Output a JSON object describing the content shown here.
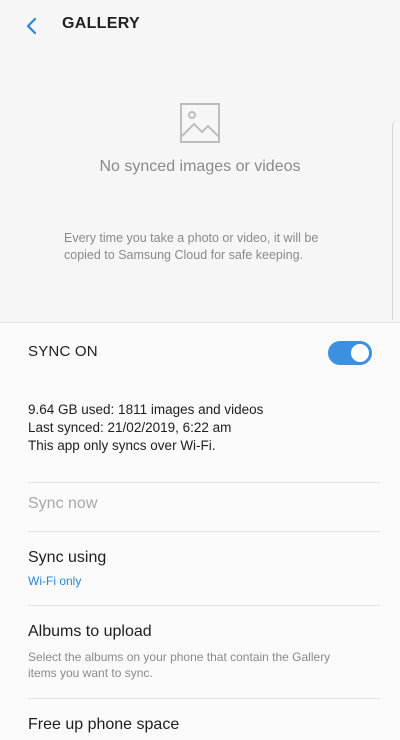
{
  "header": {
    "title": "GALLERY",
    "back_icon": "chevron-left-icon"
  },
  "empty_state": {
    "icon": "image-placeholder-icon",
    "title": "No synced images or videos",
    "description": "Every time you take a photo or video, it will be copied to Samsung Cloud for safe keeping."
  },
  "sync": {
    "label": "SYNC ON",
    "enabled": true,
    "accent_color": "#3d8fe0"
  },
  "info": {
    "usage": "9.64 GB  used: 1811 images and videos",
    "last_synced": "Last synced: 21/02/2019, 6:22 am",
    "wifi_note": "This app only syncs over Wi-Fi."
  },
  "actions": {
    "sync_now": "Sync now",
    "sync_using": {
      "title": "Sync using",
      "value": "Wi-Fi only"
    },
    "albums_to_upload": {
      "title": "Albums to upload",
      "description": "Select the albums on your phone that contain the Gallery items you want to sync."
    },
    "free_up_space": {
      "title": "Free up phone space"
    }
  }
}
